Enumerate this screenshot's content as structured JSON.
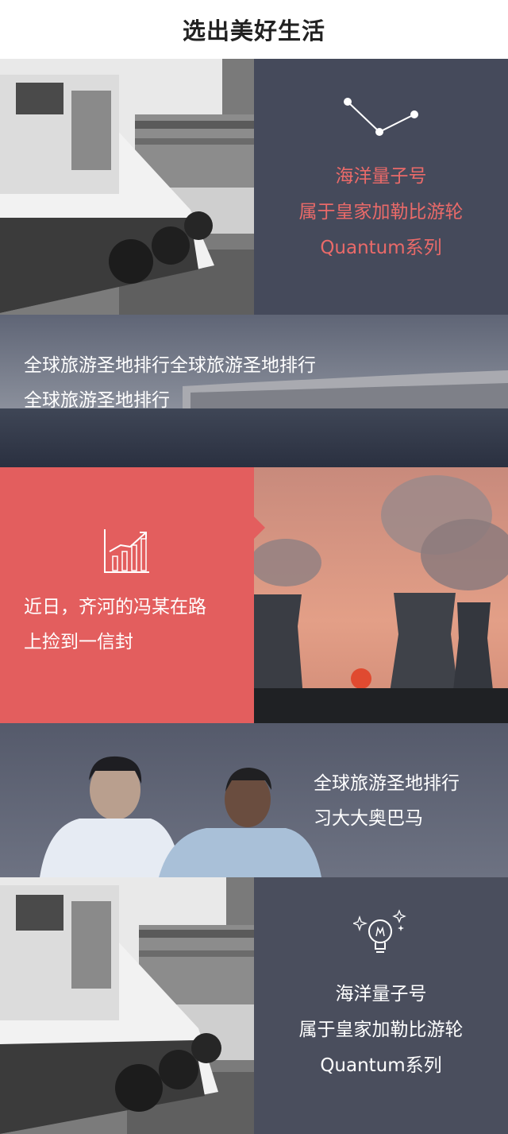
{
  "header": {
    "title": "选出美好生活"
  },
  "section1": {
    "icon": "line-graph-icon",
    "lines": [
      "海洋量子号",
      "属于皇家加勒比游轮",
      "Quantum系列"
    ]
  },
  "section2": {
    "lines": [
      "全球旅游圣地排行全球旅游圣地排行",
      "全球旅游圣地排行"
    ]
  },
  "section3": {
    "icon": "bar-chart-icon",
    "lines": [
      "近日，齐河的冯某在路",
      "上捡到一信封"
    ]
  },
  "section4": {
    "lines": [
      "全球旅游圣地排行",
      "习大大奥巴马"
    ]
  },
  "section5": {
    "icon": "lightbulb-icon",
    "lines": [
      "海洋量子号",
      "属于皇家加勒比游轮",
      "Quantum系列"
    ]
  },
  "colors": {
    "dark_panel": "#454a5b",
    "red_panel": "#e35e5e",
    "salmon_text": "#ea6a69"
  }
}
